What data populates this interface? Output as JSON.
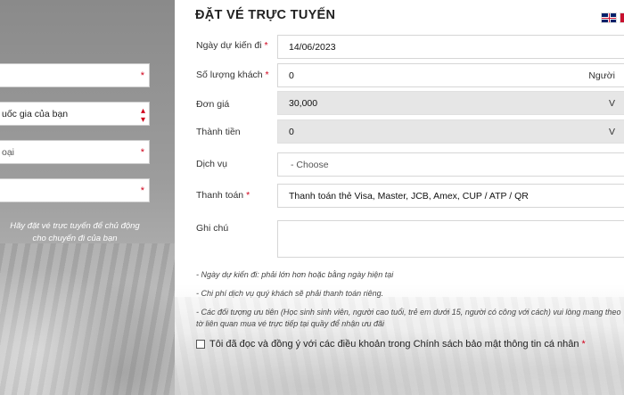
{
  "left": {
    "name_required": "*",
    "country_select": "uốc gia của bạn",
    "phone_partial": "oại",
    "phone_required": "*",
    "email_required": "*",
    "note_line1": "Hãy đặt vé trực tuyến để chủ động",
    "note_line2": "cho chuyến đi của bạn"
  },
  "form": {
    "title": "ĐẶT VÉ TRỰC TUYẾN",
    "flags": [
      "uk-flag-icon",
      "second-flag-icon"
    ],
    "date_label": "Ngày dự kiến đi",
    "date_value": "14/06/2023",
    "guests_label": "Số lượng khách",
    "guests_value": "0",
    "guests_suffix": "Người",
    "price_label": "Đơn giá",
    "price_value": "30,000",
    "price_suffix": "V",
    "total_label": "Thành tiền",
    "total_value": "0",
    "total_suffix": "V",
    "service_label": "Dịch vụ",
    "service_value": "- Choose",
    "payment_label": "Thanh toán",
    "payment_value": "Thanh toán thẻ Visa, Master, JCB, Amex, CUP / ATP / QR",
    "note_label": "Ghi chú",
    "required_mark": "*"
  },
  "notes": [
    "- Ngày dự kiến đi: phải lớn hơn hoặc bằng ngày hiện tại",
    "- Chi phí dịch vụ quý khách sẽ phải thanh toán riêng.",
    "- Các đối tượng ưu tiên (Học sinh sinh viên, người cao tuổi, trẻ em dưới 15, người có công với cách) vui lòng mang theo",
    "tờ liên quan mua vé trực tiếp tại quầy để nhận ưu đãi"
  ],
  "consent": {
    "text": "Tôi đã đọc và đồng ý với các điều khoản trong Chính sách bảo mật thông tin cá nhân",
    "required": "*"
  },
  "colors": {
    "required": "#d0021b",
    "readonly_bg": "#e6e6e6"
  }
}
